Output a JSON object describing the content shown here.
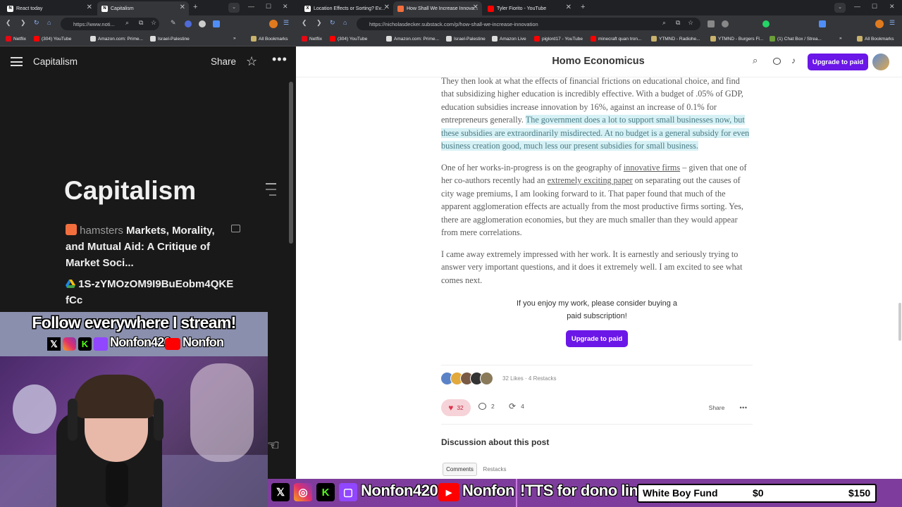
{
  "left_browser": {
    "tabs": [
      {
        "title": "React today",
        "active": false
      },
      {
        "title": "Capitalism",
        "active": true
      }
    ],
    "url": "https://www.noti...",
    "bookmarks": [
      "Netflix",
      "(304) YouTube",
      "Amazon.com: Prime...",
      "Israel-Palestine"
    ],
    "bookmarks_more": "»"
  },
  "notion": {
    "breadcrumb": "Capitalism",
    "share_label": "Share",
    "page_title": "Capitalism",
    "blocks": [
      {
        "prefix": "hamsters",
        "text": "Markets, Morality, and Mutual Aid: A Critique of Market Soci..."
      },
      {
        "prefix": "",
        "text": "1S-zYMOzOM9I9BuEobm4QKEfCc"
      }
    ]
  },
  "stream_overlay": {
    "banner_headline": "Follow everywhere I stream!",
    "handle_1": "Nonfon420",
    "handle_2": "Nonfon",
    "bottom_handle_1": "Nonfon420",
    "bottom_handle_2": "Nonfon",
    "tts_text": "!TTS for dono link",
    "fund_label": "White Boy Fund",
    "fund_current": "$0",
    "fund_goal": "$150",
    "fund_progress_fraction": 0
  },
  "right_browser": {
    "tabs": [
      {
        "title": "Location Effects or Sorting? Ev...",
        "active": false
      },
      {
        "title": "How Shall We Increase Innova...",
        "active": true
      },
      {
        "title": "Tyler Fiorito - YouTube",
        "active": false
      }
    ],
    "url": "https://nicholasdecker.substack.com/p/how-shall-we-increase-innovation",
    "bookmarks": [
      "Netflix",
      "(304) YouTube",
      "Amazon.com: Prime...",
      "Israel-Palestine",
      "Amazon Live",
      "piglord17 - YouTube",
      "minecraft quan tron...",
      "YTMND - Radiohe...",
      "YTMND - Burgers Fl...",
      "(1) Chat Box / Strea..."
    ],
    "all_bookmarks": "All Bookmarks"
  },
  "substack": {
    "publication": "Homo Economicus",
    "upgrade_label": "Upgrade to paid",
    "para1_plain": "They then look at what the effects of financial frictions on educational choice, and find that subsidizing higher education is incredibly effective. With a budget of .05% of GDP, education subsidies increase innovation by 16%, against an increase of 0.1% for entrepreneurs generally. ",
    "para1_highlight": "The government does a lot to support small businesses now, but these subsidies are extraordinarily misdirected. At no budget is a general subsidy for even business creation good, much less our present subsidies for small business.",
    "para2_a": "One of her works-in-progress is on the geography of ",
    "para2_link1": "innovative firms",
    "para2_b": " – given that one of her co-authors recently had an ",
    "para2_link2": "extremely exciting paper",
    "para2_c": " on separating out the causes of city wage premiums, I am looking forward to it. That paper found that much of the apparent agglomeration effects are actually from the most productive firms sorting. Yes, there are agglomeration economies, but they are much smaller than they would appear from mere correlations.",
    "para3": "I came away extremely impressed with her work. It is earnestly and seriously trying to answer very important questions, and it does it extremely well. I am excited to see what comes next.",
    "cta_text": "If you enjoy my work, please consider buying a paid subscription!",
    "cta_button": "Upgrade to paid",
    "likes_summary": "32 Likes · 4 Restacks",
    "like_count": "32",
    "comment_count": "2",
    "restack_count": "4",
    "share_label": "Share",
    "discussion_title": "Discussion about this post",
    "discussion_tabs": [
      "Comments",
      "Restacks"
    ]
  },
  "colors": {
    "accent_purple": "#6b17e8",
    "highlight_bg": "#d6f1f5",
    "like_pill": "#f6d3d8",
    "overlay_purple": "#7e3d9c"
  }
}
